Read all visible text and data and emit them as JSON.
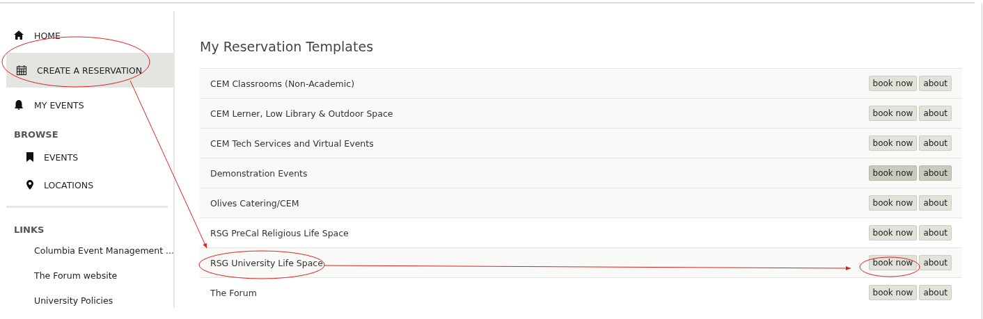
{
  "sidebar": {
    "items": [
      {
        "kind": "nav",
        "label": "HOME",
        "selected": false
      },
      {
        "kind": "nav",
        "label": "CREATE A RESERVATION",
        "selected": true
      },
      {
        "kind": "nav",
        "label": "MY EVENTS",
        "selected": false
      },
      {
        "kind": "heading",
        "label": "BROWSE"
      },
      {
        "kind": "subnav",
        "label": "EVENTS",
        "selected": false
      },
      {
        "kind": "subnav",
        "label": "LOCATIONS",
        "selected": false
      },
      {
        "kind": "divider"
      },
      {
        "kind": "heading",
        "label": "LINKS"
      },
      {
        "kind": "link",
        "label": "Columbia Event Management ..."
      },
      {
        "kind": "link",
        "label": "The Forum website"
      },
      {
        "kind": "link",
        "label": "University Policies"
      }
    ]
  },
  "main": {
    "title": "My Reservation Templates",
    "rows": [
      {
        "name": "CEM Classrooms (Non-Academic)",
        "hovered": false,
        "buttons": [
          "book now",
          "about"
        ]
      },
      {
        "name": "CEM Lerner, Low Library & Outdoor Space",
        "hovered": false,
        "buttons": [
          "book now",
          "about"
        ]
      },
      {
        "name": "CEM Tech Services and Virtual Events",
        "hovered": false,
        "buttons": [
          "book now",
          "about"
        ]
      },
      {
        "name": "Demonstration Events",
        "hovered": true,
        "buttons": [
          "book now",
          "about"
        ]
      },
      {
        "name": "Olives Catering/CEM",
        "hovered": false,
        "buttons": [
          "book now",
          "about"
        ]
      },
      {
        "name": "RSG PreCal Religious Life Space",
        "hovered": false,
        "buttons": [
          "book now",
          "about"
        ]
      },
      {
        "name": "RSG University Life Space",
        "hovered": false,
        "buttons": [
          "book now",
          "about"
        ]
      },
      {
        "name": "The Forum",
        "hovered": false,
        "buttons": [
          "book now",
          "about"
        ]
      }
    ]
  }
}
